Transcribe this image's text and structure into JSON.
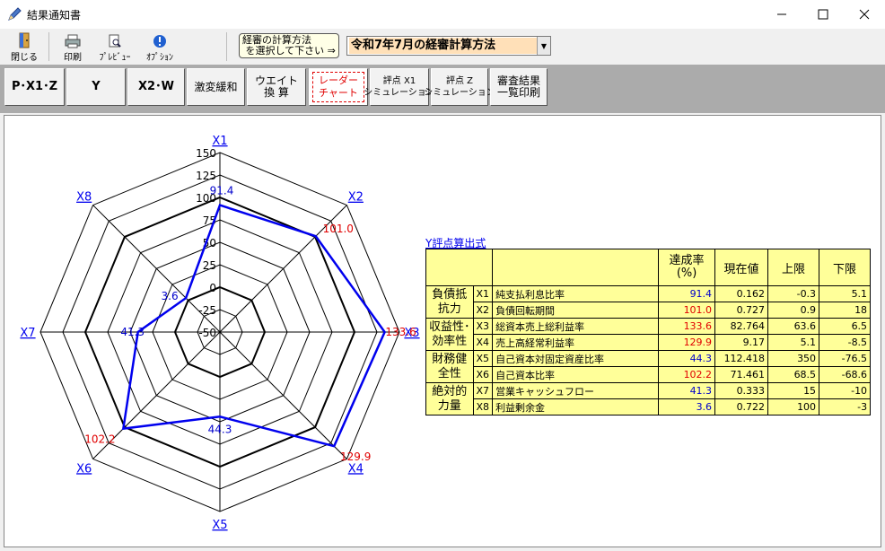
{
  "window": {
    "title": "結果通知書"
  },
  "toolbar": {
    "close_label": "閉じる",
    "print_label": "印刷",
    "preview_label": "ﾌﾟﾚﾋﾞｭｰ",
    "options_label": "ｵﾌﾟｼｮﾝ",
    "calc_method_label": "経審の計算方法\n を選択して下さい ⇒",
    "calc_method_value": "令和7年7月の経審計算方法"
  },
  "nav": [
    {
      "label": "P･X1･Z"
    },
    {
      "label": "Y"
    },
    {
      "label": "X2･W"
    },
    {
      "label": "激変緩和"
    },
    {
      "label": "ウエイト\n換 算"
    },
    {
      "label": "レーダー\nチャート"
    },
    {
      "label": "評点 X1\nシミュレーション"
    },
    {
      "label": "評点 Z\nシミュレーション"
    },
    {
      "label": "審査結果\n一覧印刷"
    }
  ],
  "chart_data": {
    "type": "radar",
    "axes": [
      "X1",
      "X2",
      "X3",
      "X4",
      "X5",
      "X6",
      "X7",
      "X8"
    ],
    "ticks": [
      "150",
      "125",
      "100",
      "75",
      "50",
      "25",
      "0",
      "-25",
      "-50"
    ],
    "range": [
      -50,
      150
    ],
    "reference_rings": [
      100,
      0
    ],
    "series": [
      {
        "values": [
          91.4,
          101.0,
          133.6,
          129.9,
          44.3,
          102.2,
          41.3,
          3.6
        ],
        "color": "#0000ee"
      }
    ],
    "value_labels": [
      "91.4",
      "101.0",
      "133.6",
      "129.9",
      "44.3",
      "102.2",
      "41.3",
      "3.6"
    ],
    "label_colors": [
      "#0000cc",
      "#e00000",
      "#e00000",
      "#e00000",
      "#0000cc",
      "#e00000",
      "#0000cc",
      "#0000cc"
    ]
  },
  "formula": {
    "title": "Y評点算出式",
    "headers": [
      "達成率\n(%)",
      "現在値",
      "上限",
      "下限"
    ],
    "groups": [
      "負債抵\n抗力",
      "収益性･\n効率性",
      "財務健\n全性",
      "絶対的\n力量"
    ],
    "rows": [
      {
        "code": "X1",
        "name": "純支払利息比率",
        "rate": "91.4",
        "current": "0.162",
        "upper": "-0.3",
        "lower": "5.1",
        "color": "blue"
      },
      {
        "code": "X2",
        "name": "負債回転期間",
        "rate": "101.0",
        "current": "0.727",
        "upper": "0.9",
        "lower": "18",
        "color": "red"
      },
      {
        "code": "X3",
        "name": "総資本売上総利益率",
        "rate": "133.6",
        "current": "82.764",
        "upper": "63.6",
        "lower": "6.5",
        "color": "red"
      },
      {
        "code": "X4",
        "name": "売上高経常利益率",
        "rate": "129.9",
        "current": "9.17",
        "upper": "5.1",
        "lower": "-8.5",
        "color": "red"
      },
      {
        "code": "X5",
        "name": "自己資本対固定資産比率",
        "rate": "44.3",
        "current": "112.418",
        "upper": "350",
        "lower": "-76.5",
        "color": "blue"
      },
      {
        "code": "X6",
        "name": "自己資本比率",
        "rate": "102.2",
        "current": "71.461",
        "upper": "68.5",
        "lower": "-68.6",
        "color": "red"
      },
      {
        "code": "X7",
        "name": "営業キャッシュフロー",
        "rate": "41.3",
        "current": "0.333",
        "upper": "15",
        "lower": "-10",
        "color": "blue"
      },
      {
        "code": "X8",
        "name": "利益剰余金",
        "rate": "3.6",
        "current": "0.722",
        "upper": "100",
        "lower": "-3",
        "color": "blue"
      }
    ]
  }
}
